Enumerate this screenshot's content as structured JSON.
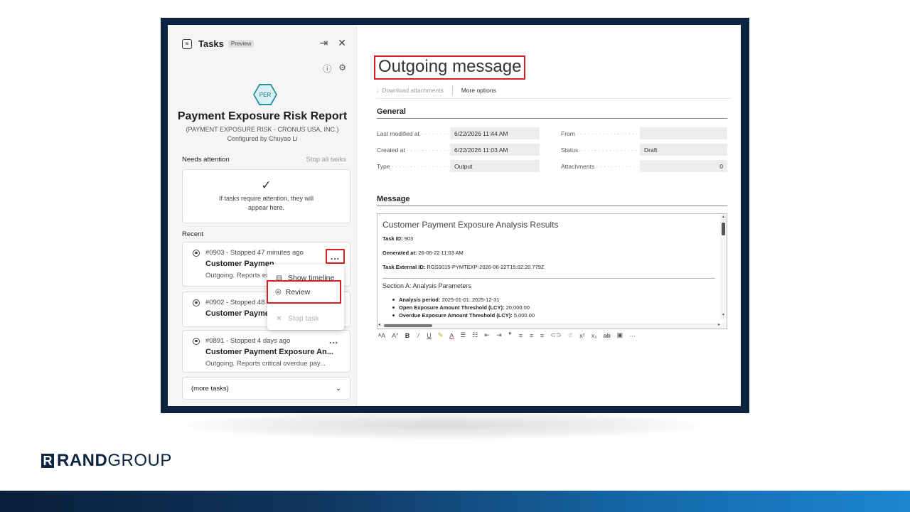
{
  "tasks_pane": {
    "title": "Tasks",
    "badge": "Preview",
    "agent_initials": "PER",
    "agent_name": "Payment Exposure Risk Report",
    "agent_subtitle": "(PAYMENT EXPOSURE RISK - CRONUS USA, INC.)",
    "configured_by": "Configured by Chuyao Li",
    "needs_attention_label": "Needs attention",
    "stop_all_label": "Stop all tasks",
    "attention_message": "If tasks require attention, they will appear here.",
    "recent_label": "Recent",
    "recent_tasks": [
      {
        "status": "#0903 - Stopped 47 minutes ago",
        "title": "Customer Paymen",
        "desc": "Outgoing. Reports ex"
      },
      {
        "status": "#0902 - Stopped 48",
        "title": "Customer Paymen",
        "desc": ""
      },
      {
        "status": "#0891 - Stopped 4 days ago",
        "title": "Customer Payment Exposure An...",
        "desc": "Outgoing. Reports critical overdue pay..."
      }
    ],
    "more_options_label": "...",
    "context_menu": {
      "show_timeline": "Show timeline",
      "review": "Review",
      "stop_task": "Stop task"
    },
    "more_tasks_label": "(more tasks)"
  },
  "main": {
    "title": "Outgoing message",
    "commands": {
      "download": "Download attachments",
      "more": "More options"
    },
    "general_title": "General",
    "fields": {
      "last_modified_label": "Last modified at",
      "last_modified_value": "6/22/2026 11:44 AM",
      "created_label": "Created at",
      "created_value": "6/22/2026 11:03 AM",
      "type_label": "Type",
      "type_value": "Output",
      "from_label": "From",
      "from_value": "",
      "status_label": "Status",
      "status_value": "Draft",
      "attachments_label": "Attachments",
      "attachments_value": "0"
    },
    "message_title": "Message",
    "message": {
      "heading": "Customer Payment Exposure Analysis Results",
      "task_id_label": "Task ID:",
      "task_id_value": "903",
      "generated_label": "Generated at:",
      "generated_value": "26-06-22 11:03 AM",
      "external_id_label": "Task External ID:",
      "external_id_value": "RGS0015-PYMTEXP-2026-06-22T15:02:20.779Z",
      "section_a": "Section A: Analysis Parameters",
      "params": [
        {
          "label": "Analysis period:",
          "value": "2025-01-01..2025-12-31"
        },
        {
          "label": "Open Exposure Amount Threshold (LCY):",
          "value": "20,000.00"
        },
        {
          "label": "Overdue Exposure Amount Threshold (LCY):",
          "value": "5,000.00"
        }
      ]
    }
  },
  "brand": {
    "mark": "R",
    "name_bold": "RAND",
    "name_light": "GROUP"
  },
  "colors": {
    "frame": "#0d2440",
    "highlight": "#d81f26",
    "agent_hex": "#2f8e9d"
  }
}
